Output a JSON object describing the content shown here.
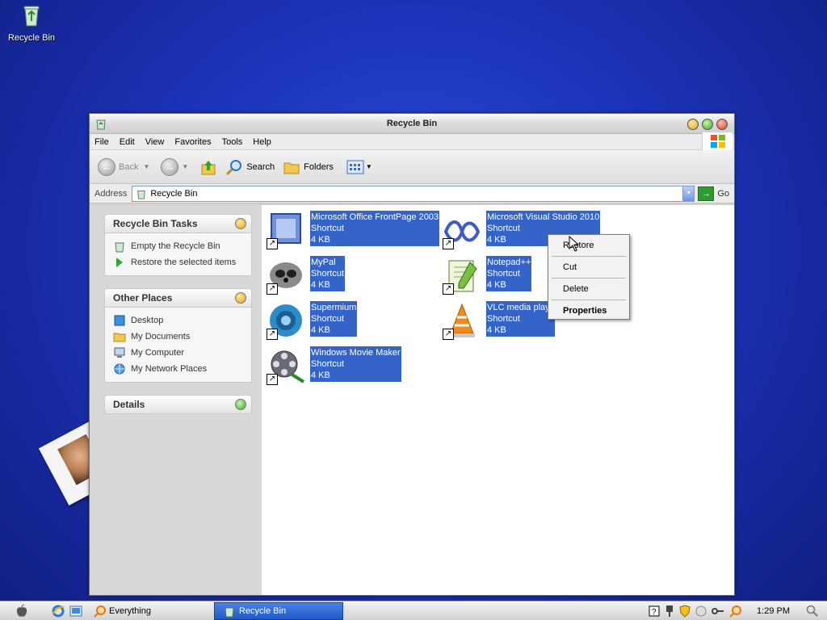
{
  "desktop": {
    "recycle_bin_label": "Recycle Bin"
  },
  "window": {
    "title": "Recycle Bin",
    "menu": [
      "File",
      "Edit",
      "View",
      "Favorites",
      "Tools",
      "Help"
    ],
    "toolbar": {
      "back_label": "Back",
      "search_label": "Search",
      "folders_label": "Folders"
    },
    "address": {
      "label": "Address",
      "value": "Recycle Bin",
      "go_label": "Go"
    },
    "tasks_panel": {
      "title": "Recycle Bin Tasks",
      "items": [
        "Empty the Recycle Bin",
        "Restore the selected items"
      ]
    },
    "places_panel": {
      "title": "Other Places",
      "items": [
        "Desktop",
        "My Documents",
        "My Computer",
        "My Network Places"
      ]
    },
    "details_panel": {
      "title": "Details"
    },
    "files": [
      {
        "name": "Microsoft Office FrontPage 2003",
        "type": "Shortcut",
        "size": "4 KB",
        "icon": "frontpage-icon"
      },
      {
        "name": "Microsoft Visual Studio 2010",
        "type": "Shortcut",
        "size": "4 KB",
        "icon": "visual-studio-icon"
      },
      {
        "name": "MyPal",
        "type": "Shortcut",
        "size": "4 KB",
        "icon": "mypal-icon"
      },
      {
        "name": "Notepad++",
        "type": "Shortcut",
        "size": "4 KB",
        "icon": "notepadpp-icon"
      },
      {
        "name": "Supermium",
        "type": "Shortcut",
        "size": "4 KB",
        "icon": "supermium-icon"
      },
      {
        "name": "VLC media player",
        "type": "Shortcut",
        "size": "4 KB",
        "icon": "vlc-icon"
      },
      {
        "name": "Windows Movie Maker",
        "type": "Shortcut",
        "size": "4 KB",
        "icon": "movie-maker-icon"
      }
    ],
    "context_menu": [
      "Restore",
      "Cut",
      "Delete",
      "Properties"
    ]
  },
  "taskbar": {
    "everything_label": "Everything",
    "active_window_label": "Recycle Bin",
    "clock": "1:29 PM"
  },
  "colors": {
    "selection": "#3464c8",
    "desktop": "#1c33b8"
  }
}
